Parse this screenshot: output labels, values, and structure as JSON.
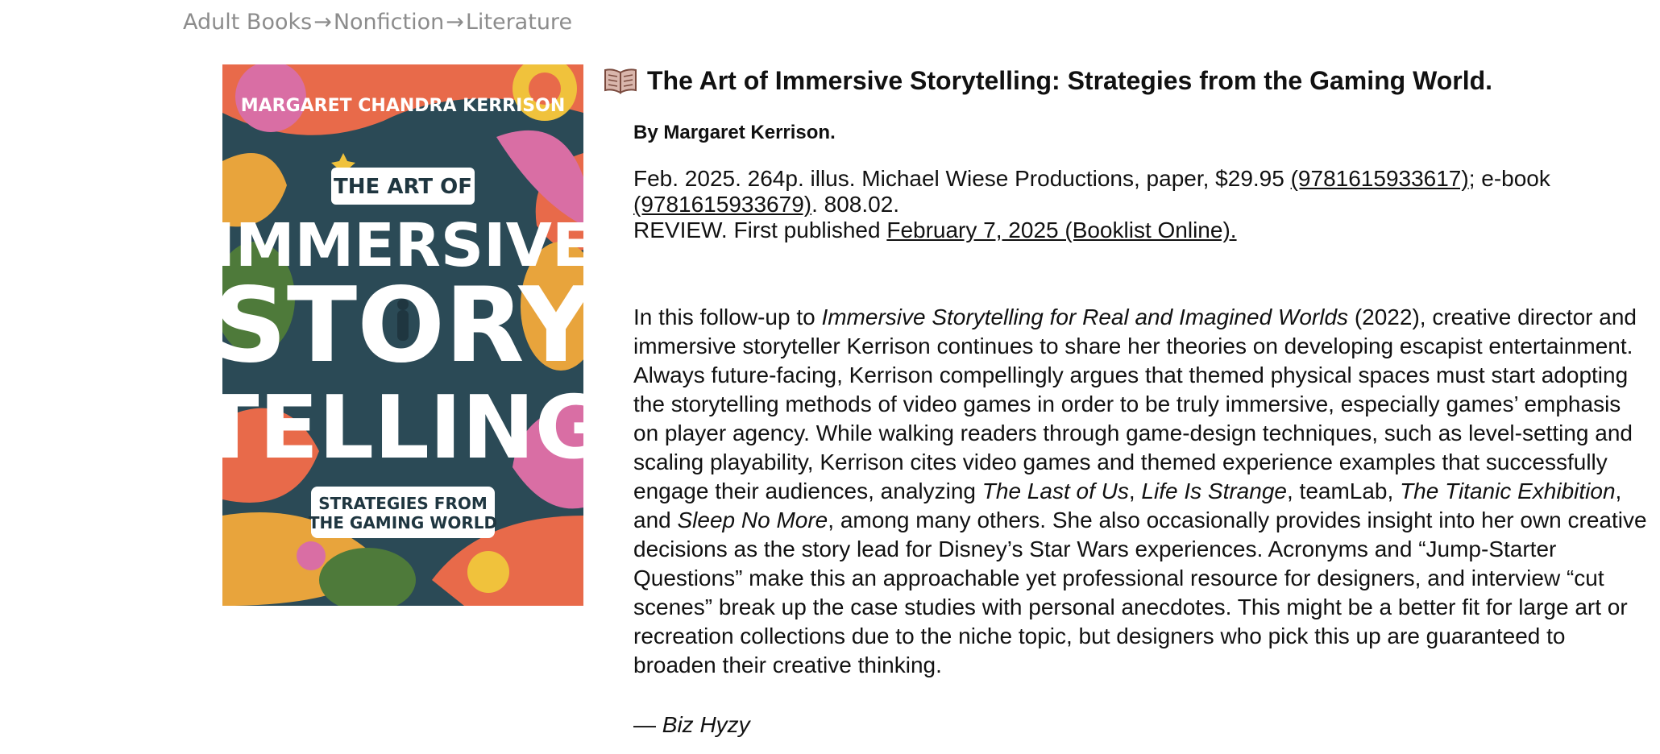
{
  "breadcrumb": {
    "items": [
      "Adult Books",
      "Nonfiction",
      "Literature"
    ],
    "separator": "→"
  },
  "cover": {
    "author": "MARGARET CHANDRA KERRISON",
    "line1": "THE ART OF",
    "line2": "IMMERSIVE",
    "line3": "STORY",
    "line4": "TELLING",
    "subtitle1": "STRATEGIES FROM",
    "subtitle2": "THE GAMING WORLD",
    "palette": [
      "#2b4a56",
      "#e8a43c",
      "#e86a4a",
      "#d96ea4",
      "#4e7a3a",
      "#f0c23c",
      "#1f3640"
    ]
  },
  "book": {
    "icon": "open-book-icon",
    "title": "The Art of Immersive Storytelling: Strategies from the Gaming World.",
    "byline": "By Margaret Kerrison.",
    "pub_prefix": "Feb. 2025. 264p. illus. Michael Wiese Productions, paper, $29.95 ",
    "isbn_paper": "(9781615933617)",
    "ebook_label": "; e-book ",
    "isbn_ebook": "(9781615933679)",
    "pub_suffix": ". 808.02.",
    "review_prefix": "REVIEW. First published ",
    "review_link": "February 7, 2025 (Booklist Online)."
  },
  "review": {
    "p1": "In this follow-up to ",
    "i1": "Immersive Storytelling for Real and Imagined Worlds",
    "p2": " (2022), creative director and immersive storyteller Kerrison continues to share her theories on developing escapist entertainment. Always future-facing, Kerrison compellingly argues that themed physical spaces must start adopting the storytelling methods of video games in order to be truly immersive, especially games’ emphasis on player agency. While walking readers through game-design techniques, such as level-setting and scaling playability, Kerrison cites video games and themed experience examples that successfully engage their audiences, analyzing ",
    "i2": "The Last of Us",
    "p3": ", ",
    "i3": "Life Is Strange",
    "p4": ", teamLab, ",
    "i4": "The Titanic Exhibition",
    "p5": ", and ",
    "i5": "Sleep No More",
    "p6": ", among many others. She also occasionally provides insight into her own creative decisions as the story lead for Disney’s Star Wars experiences. Acronyms and “Jump-Starter Questions” make this an approachable yet professional resource for designers, and interview “cut scenes” break up the case studies with personal anecdotes. This might be a better fit for large art or recreation collections due to the niche topic, but designers who pick this up are guaranteed to broaden their creative thinking.",
    "sig_dash": "— ",
    "sig_name": "Biz Hyzy"
  }
}
